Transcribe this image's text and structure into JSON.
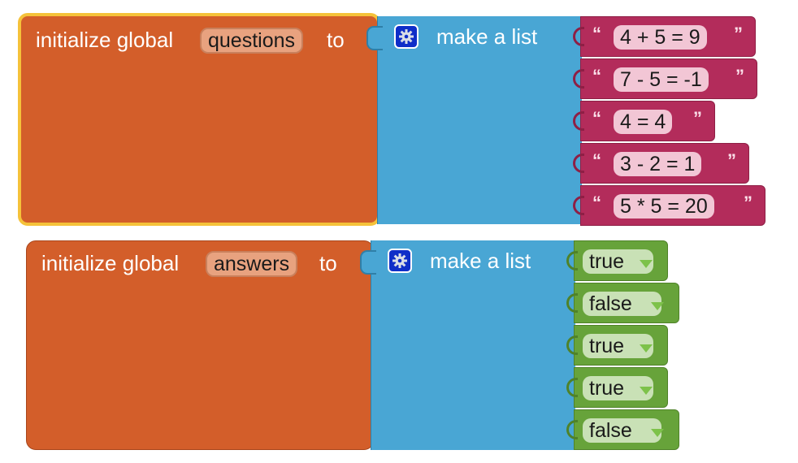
{
  "blocks": [
    {
      "keyword_initialize": "initialize global",
      "variable": "questions",
      "keyword_to": "to",
      "list_label": "make a list",
      "items": [
        "4 + 5 = 9",
        "7 - 5 = -1",
        "4 = 4",
        "3 - 2 = 1",
        "5 * 5 = 20"
      ],
      "item_type": "text"
    },
    {
      "keyword_initialize": "initialize global",
      "variable": "answers",
      "keyword_to": "to",
      "list_label": "make a list",
      "items": [
        "true",
        "false",
        "true",
        "true",
        "false"
      ],
      "item_type": "logic"
    }
  ],
  "quote_open": "“",
  "quote_close": "”",
  "icons": {
    "mutator": "gear-icon",
    "dropdown": "chevron-down-icon"
  },
  "colors": {
    "variable_block": "#d35e2a",
    "list_block": "#49a6d4",
    "text_block": "#b32c5b",
    "logic_block": "#67a33a",
    "selection_highlight": "#f5c23a",
    "mutator_button": "#0f2ec8"
  }
}
